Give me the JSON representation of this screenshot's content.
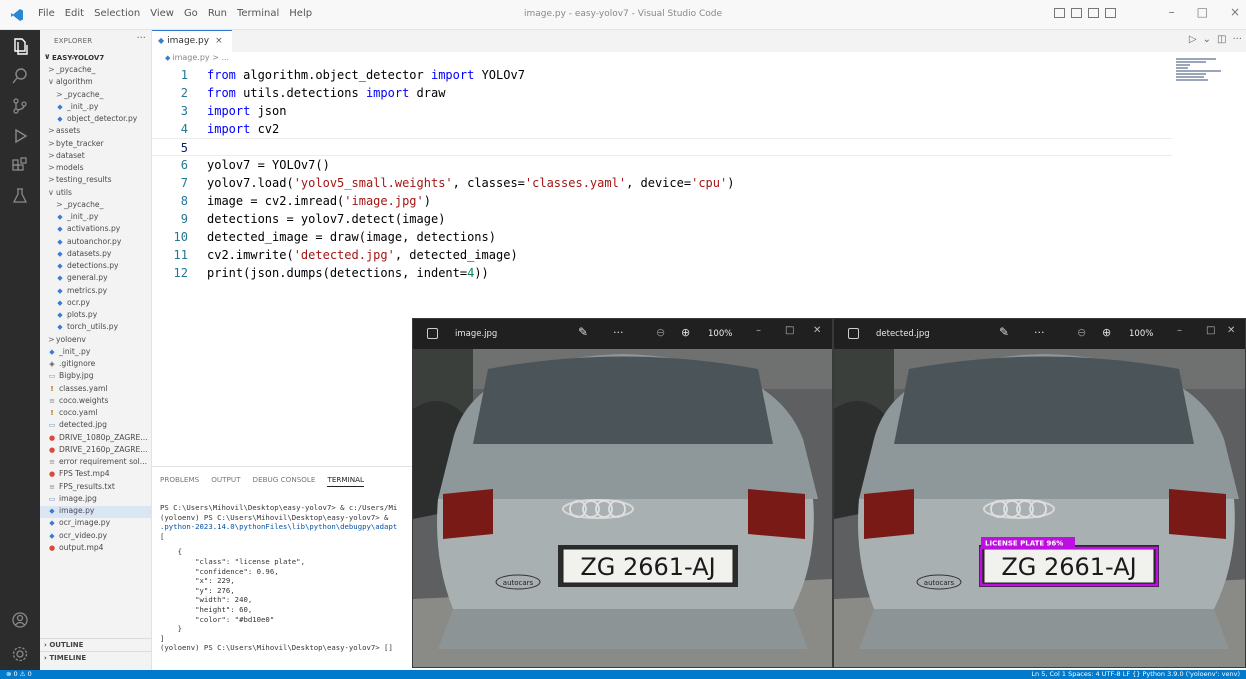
{
  "window": {
    "title": "image.py - easy-yolov7 - Visual Studio Code",
    "menu": [
      "File",
      "Edit",
      "Selection",
      "View",
      "Go",
      "Run",
      "Terminal",
      "Help"
    ],
    "controls": [
      "–",
      "□",
      "×"
    ]
  },
  "sidebar": {
    "title": "EXPLORER",
    "actions": "···",
    "root": "EASY-YOLOV7",
    "tree": [
      {
        "label": "_pycache_",
        "type": "folder",
        "chev": ">",
        "indent": 1
      },
      {
        "label": "algorithm",
        "type": "folder",
        "chev": "∨",
        "indent": 1
      },
      {
        "label": "_pycache_",
        "type": "folder",
        "chev": ">",
        "indent": 2
      },
      {
        "label": "_init_.py",
        "type": "py",
        "indent": 2
      },
      {
        "label": "object_detector.py",
        "type": "py",
        "indent": 2
      },
      {
        "label": "assets",
        "type": "folder",
        "chev": ">",
        "indent": 1
      },
      {
        "label": "byte_tracker",
        "type": "folder",
        "chev": ">",
        "indent": 1
      },
      {
        "label": "dataset",
        "type": "folder",
        "chev": ">",
        "indent": 1
      },
      {
        "label": "models",
        "type": "folder",
        "chev": ">",
        "indent": 1
      },
      {
        "label": "testing_results",
        "type": "folder",
        "chev": ">",
        "indent": 1
      },
      {
        "label": "utils",
        "type": "folder",
        "chev": "∨",
        "indent": 1
      },
      {
        "label": "_pycache_",
        "type": "folder",
        "chev": ">",
        "indent": 2
      },
      {
        "label": "_init_.py",
        "type": "py",
        "indent": 2
      },
      {
        "label": "activations.py",
        "type": "py",
        "indent": 2
      },
      {
        "label": "autoanchor.py",
        "type": "py",
        "indent": 2
      },
      {
        "label": "datasets.py",
        "type": "py",
        "indent": 2
      },
      {
        "label": "detections.py",
        "type": "py",
        "indent": 2
      },
      {
        "label": "general.py",
        "type": "py",
        "indent": 2
      },
      {
        "label": "metrics.py",
        "type": "py",
        "indent": 2
      },
      {
        "label": "ocr.py",
        "type": "py",
        "indent": 2
      },
      {
        "label": "plots.py",
        "type": "py",
        "indent": 2
      },
      {
        "label": "torch_utils.py",
        "type": "py",
        "indent": 2
      },
      {
        "label": "yoloenv",
        "type": "folder",
        "chev": ">",
        "indent": 1
      },
      {
        "label": "_init_.py",
        "type": "py",
        "indent": 1
      },
      {
        "label": ".gitignore",
        "type": "git",
        "indent": 1
      },
      {
        "label": "Bigby.jpg",
        "type": "img",
        "indent": 1
      },
      {
        "label": "classes.yaml",
        "type": "yaml",
        "indent": 1
      },
      {
        "label": "coco.weights",
        "type": "txt",
        "indent": 1
      },
      {
        "label": "coco.yaml",
        "type": "yaml",
        "indent": 1
      },
      {
        "label": "detected.jpg",
        "type": "img",
        "indent": 1
      },
      {
        "label": "DRIVE_1080p_ZAGRE...",
        "type": "mp4",
        "indent": 1
      },
      {
        "label": "DRIVE_2160p_ZAGRE...",
        "type": "mp4",
        "indent": 1
      },
      {
        "label": "error requirement sol...",
        "type": "txt",
        "indent": 1
      },
      {
        "label": "FPS Test.mp4",
        "type": "mp4",
        "indent": 1
      },
      {
        "label": "FPS_results.txt",
        "type": "txt",
        "indent": 1
      },
      {
        "label": "image.jpg",
        "type": "img",
        "indent": 1
      },
      {
        "label": "image.py",
        "type": "py",
        "indent": 1,
        "selected": true
      },
      {
        "label": "ocr_image.py",
        "type": "py",
        "indent": 1
      },
      {
        "label": "ocr_video.py",
        "type": "py",
        "indent": 1
      },
      {
        "label": "output.mp4",
        "type": "mp4",
        "indent": 1
      }
    ],
    "outline": "OUTLINE",
    "timeline": "TIMELINE"
  },
  "editor": {
    "tab": "image.py",
    "tab_close": "×",
    "breadcrumb": "image.py > ...",
    "lines": [
      {
        "n": "1",
        "html": "<span class='kw'>from</span> algorithm.object_detector <span class='kw'>import</span> YOLOv7"
      },
      {
        "n": "2",
        "html": "<span class='kw'>from</span> utils.detections <span class='kw'>import</span> draw"
      },
      {
        "n": "3",
        "html": "<span class='kw'>import</span> json"
      },
      {
        "n": "4",
        "html": "<span class='kw'>import</span> cv2"
      },
      {
        "n": "5",
        "html": "",
        "current": true
      },
      {
        "n": "6",
        "html": "yolov7 = YOLOv7()"
      },
      {
        "n": "7",
        "html": "yolov7.load(<span class='str'>'yolov5_small.weights'</span>, classes=<span class='str'>'classes.yaml'</span>, device=<span class='str'>'cpu'</span>)"
      },
      {
        "n": "8",
        "html": "image = cv2.imread(<span class='str'>'image.jpg'</span>)"
      },
      {
        "n": "9",
        "html": "detections = yolov7.detect(image)"
      },
      {
        "n": "10",
        "html": "detected_image = draw(image, detections)"
      },
      {
        "n": "11",
        "html": "cv2.imwrite(<span class='str'>'detected.jpg'</span>, detected_image)"
      },
      {
        "n": "12",
        "html": "print(json.dumps(detections, indent=<span class='n'>4</span>))"
      }
    ]
  },
  "panel": {
    "tabs": [
      "PROBLEMS",
      "OUTPUT",
      "DEBUG CONSOLE",
      "TERMINAL"
    ],
    "active_tab": "TERMINAL",
    "terminal": [
      "PS C:\\Users\\Mihovil\\Desktop\\easy-yolov7> & c:/Users/Mi",
      "(yoloenv) PS C:\\Users\\Mihovil\\Desktop\\easy-yolov7> &",
      ".python-2023.14.0\\pythonFiles\\lib\\python\\debugpy\\adapt",
      "[",
      "    {",
      "        \"class\": \"license plate\",",
      "        \"confidence\": 0.96,",
      "        \"x\": 229,",
      "        \"y\": 276,",
      "        \"width\": 240,",
      "        \"height\": 60,",
      "        \"color\": \"#bd10e0\"",
      "    }",
      "]",
      "(yoloenv) PS C:\\Users\\Mihovil\\Desktop\\easy-yolov7> []"
    ]
  },
  "viewers": [
    {
      "filename": "image.jpg",
      "zoom": "100%",
      "plate": "ZG 2661-AJ",
      "dealer": "autocars"
    },
    {
      "filename": "detected.jpg",
      "zoom": "100%",
      "plate": "ZG 2661-AJ",
      "dealer": "autocars",
      "detection_label": "LICENSE PLATE 96%",
      "detection_color": "#bd10e0"
    }
  ],
  "statusbar": {
    "left": "⊗ 0 ⚠ 0",
    "right": "Ln 5, Col 1   Spaces: 4   UTF-8   LF   {} Python   3.9.0 ('yoloenv': venv)"
  }
}
